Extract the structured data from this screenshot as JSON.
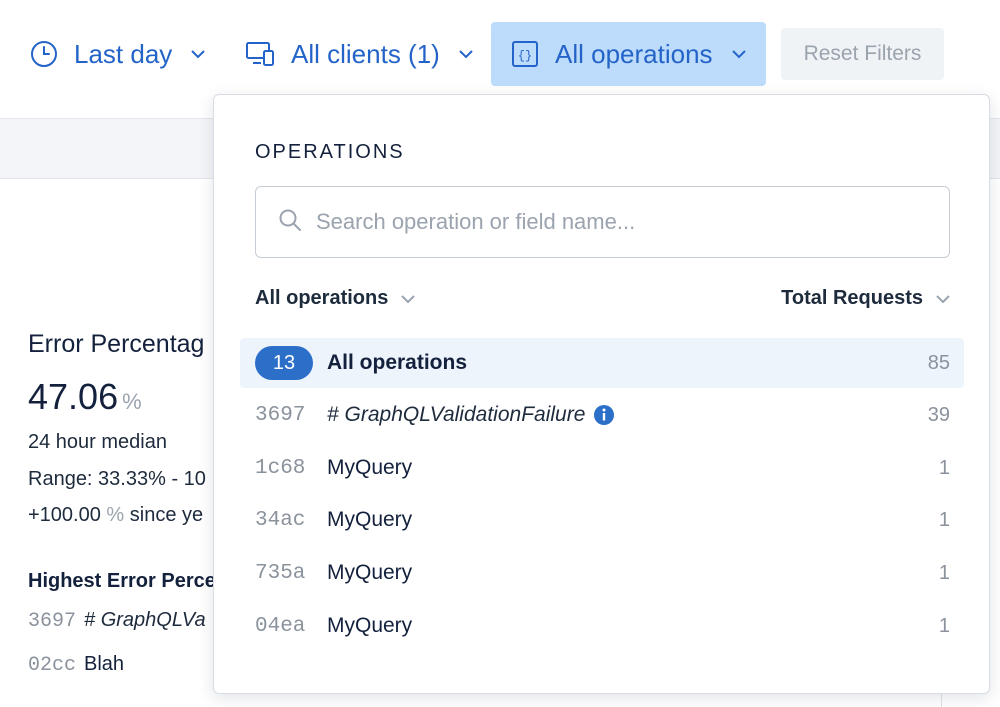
{
  "filters": {
    "time_label": "Last day",
    "clients_label": "All clients (1)",
    "operations_label": "All operations",
    "reset_label": "Reset Filters"
  },
  "background": {
    "title": "Error Percentag",
    "metric_value": "47.06",
    "metric_unit": "%",
    "median_label": "24 hour median",
    "range_label": "Range: 33.33% - 10",
    "change_value": "+100.00",
    "change_unit": "%",
    "change_suffix": "since ye",
    "highest_label": "Highest Error Perce",
    "ops": [
      {
        "hash": "3697",
        "name": "# GraphQLVa"
      },
      {
        "hash": "02cc",
        "name": "Blah"
      }
    ]
  },
  "dropdown": {
    "heading": "OPERATIONS",
    "search_placeholder": "Search operation or field name...",
    "sort_left": "All operations",
    "sort_right": "Total Requests",
    "all_row": {
      "badge": "13",
      "name": "All operations",
      "count": "85"
    },
    "rows": [
      {
        "hash": "3697",
        "name": "# GraphQLValidationFailure",
        "count": "39"
      },
      {
        "hash": "1c68",
        "name": "MyQuery",
        "count": "1"
      },
      {
        "hash": "34ac",
        "name": "MyQuery",
        "count": "1"
      },
      {
        "hash": "735a",
        "name": "MyQuery",
        "count": "1"
      },
      {
        "hash": "04ea",
        "name": "MyQuery",
        "count": "1"
      }
    ]
  },
  "colors": {
    "accent": "#2464c8",
    "active_filter_bg": "#bddbfb",
    "badge_bg": "#2c6fc8",
    "muted": "#8a929c"
  },
  "icons": {
    "time": "clock-icon",
    "clients": "devices-icon",
    "operations": "braces-icon",
    "search": "search-icon",
    "info": "info-icon",
    "chevron": "chevron-down-icon"
  }
}
